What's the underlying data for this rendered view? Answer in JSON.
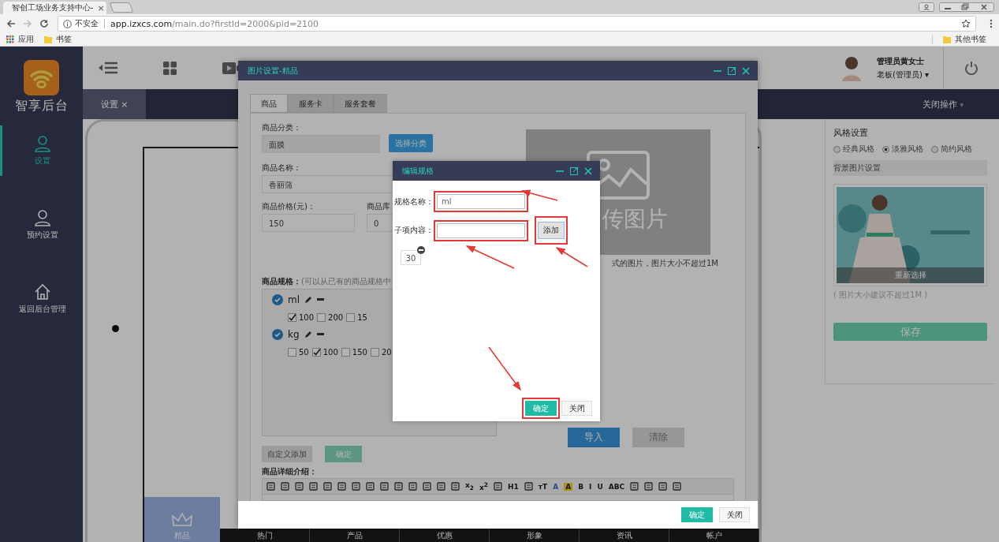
{
  "browser": {
    "tab_title": "智创工场业务支持中心-",
    "tab_close": "×",
    "security": "不安全",
    "url_host": "app.izxcs.com",
    "url_path": "/main.do?firstId=2000&pid=2100",
    "bookmarks": [
      "应用",
      "书签"
    ],
    "other_bookmarks": "其他书签"
  },
  "sidebar": {
    "logo_text": "智享后台",
    "items": [
      {
        "label": "设置",
        "selected": true
      },
      {
        "label": "预约设置",
        "selected": false
      },
      {
        "label": "返回后台管理",
        "selected": false
      }
    ]
  },
  "header": {
    "user_name": "管理员黄女士",
    "user_role": "老板(管理员)",
    "role_caret": "▾"
  },
  "page_tabs": [
    {
      "label": "设置",
      "close": "×",
      "selected": true
    }
  ],
  "close_operations": "关闭操作",
  "close_operations_caret": "▾",
  "phone_preview": {
    "featured": "精品",
    "nav": [
      "热门",
      "产品",
      "优惠",
      "形象",
      "资讯",
      "帐户"
    ]
  },
  "style_panel": {
    "title": "风格设置",
    "styles": [
      {
        "label": "经典风格",
        "selected": false
      },
      {
        "label": "淡雅风格",
        "selected": true
      },
      {
        "label": "简约风格",
        "selected": false
      }
    ],
    "background_title": "背景图片设置",
    "reselect": "重新选择",
    "hint": "( 图片大小建议不超过1M )",
    "save": "保存"
  },
  "modal": {
    "title": "图片设置-精品",
    "tabs": [
      {
        "label": "商品",
        "selected": true
      },
      {
        "label": "服务卡",
        "selected": false
      },
      {
        "label": "服务套餐",
        "selected": false
      }
    ],
    "category_label": "商品分类：",
    "category_value": "面膜",
    "choose_category": "选择分类",
    "name_label": "商品名称：",
    "name_value": "香丽蒲",
    "price_label": "商品价格(元)：",
    "price_value": "150",
    "stock_label": "商品库",
    "stock_value": "0",
    "upload_text": "传图片",
    "upload_hint": "式的图片，图片大小不超过1M",
    "spec_label": "商品规格：",
    "spec_hint": "(可以从已有的商品规格中",
    "specs": [
      {
        "name": "ml",
        "checked": true,
        "options": [
          {
            "label": "100",
            "checked": true
          },
          {
            "label": "200",
            "checked": false
          },
          {
            "label": "15",
            "checked": false
          }
        ]
      },
      {
        "name": "kg",
        "checked": true,
        "options": [
          {
            "label": "50",
            "checked": false
          },
          {
            "label": "100",
            "checked": true
          },
          {
            "label": "150",
            "checked": false
          },
          {
            "label": "20",
            "checked": false
          }
        ]
      }
    ],
    "custom_add": "自定义添加",
    "confirm_specs": "确定",
    "import": "导入",
    "clear": "清除",
    "detail_label": "商品详细介绍：",
    "toolbar": [
      {
        "kind": "icon"
      },
      {
        "kind": "icon"
      },
      {
        "kind": "icon"
      },
      {
        "kind": "icon"
      },
      {
        "kind": "icon"
      },
      {
        "kind": "icon"
      },
      {
        "kind": "icon"
      },
      {
        "kind": "icon"
      },
      {
        "kind": "icon"
      },
      {
        "kind": "icon"
      },
      {
        "kind": "icon"
      },
      {
        "kind": "icon"
      },
      {
        "kind": "icon"
      },
      {
        "kind": "icon"
      },
      {
        "kind": "text",
        "label": "x$_{2}$"
      },
      {
        "kind": "text",
        "label": "x$^{2}$"
      },
      {
        "kind": "icon"
      },
      {
        "kind": "text",
        "label": "H1"
      },
      {
        "kind": "icon"
      },
      {
        "kind": "text",
        "label": "тT"
      },
      {
        "kind": "font-color",
        "label": "A"
      },
      {
        "kind": "highlight",
        "label": "A"
      },
      {
        "kind": "text",
        "label": "B"
      },
      {
        "kind": "text",
        "label": "I"
      },
      {
        "kind": "text",
        "label": "U"
      },
      {
        "kind": "text",
        "label": "ABC"
      },
      {
        "kind": "icon"
      },
      {
        "kind": "icon"
      },
      {
        "kind": "icon"
      },
      {
        "kind": "icon"
      }
    ],
    "footer_buttons": [
      "确定",
      "关闭"
    ]
  },
  "dialog": {
    "title": "编辑规格",
    "spec_name_label": "规格名称：",
    "spec_name_value": "ml",
    "item_label": "子项内容：",
    "add": "添加",
    "items": [
      "30"
    ],
    "buttons": [
      "确定",
      "关闭"
    ]
  }
}
